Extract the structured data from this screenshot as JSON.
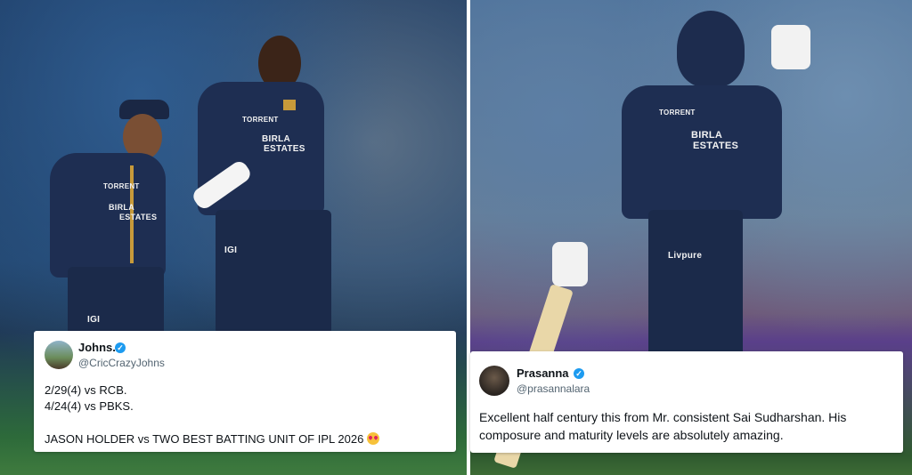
{
  "tweets": {
    "left": {
      "name": "Johns.",
      "handle": "@CricCrazyJohns",
      "lines": [
        "2/29(4) vs RCB.",
        "4/24(4) vs PBKS.",
        "JASON HOLDER vs TWO BEST BATTING UNIT OF IPL 2026"
      ],
      "emoji": "heart-eyes-emoji"
    },
    "right": {
      "name": "Prasanna",
      "handle": "@prasannalara",
      "text": "Excellent half century this from Mr. consistent Sai Sudharshan. His composure and maturity levels are absolutely amazing."
    }
  },
  "jersey_text": {
    "torrent": "TORRENT",
    "birla": "BIRLA",
    "estates": "ESTATES",
    "igi": "IGI",
    "livpure": "Livpure"
  },
  "colors": {
    "jersey": "#1e2e52",
    "trim": "#c79a3a",
    "verified": "#1d9bf0"
  }
}
